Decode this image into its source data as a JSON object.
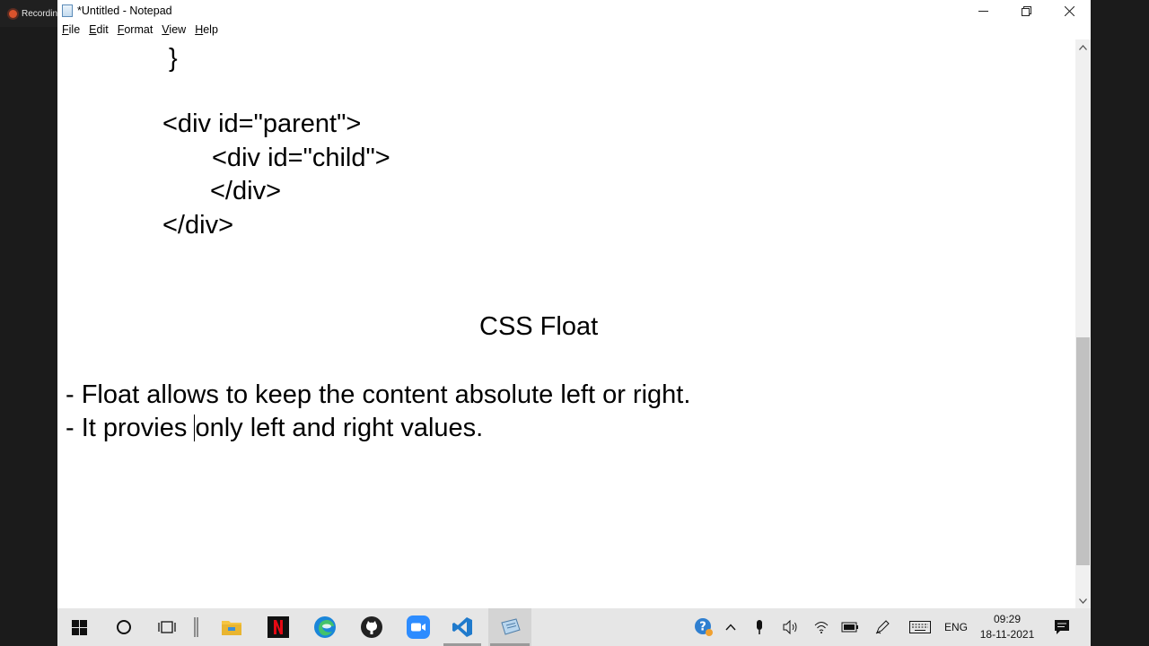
{
  "recording": {
    "label": "Recordin"
  },
  "window": {
    "title": "*Untitled - Notepad",
    "controls": {
      "minimize": "minimize-icon",
      "restore": "restore-icon",
      "close": "close-icon"
    }
  },
  "menu": [
    {
      "first": "F",
      "rest": "ile"
    },
    {
      "first": "E",
      "rest": "dit"
    },
    {
      "first": "F",
      "rest": "ormat"
    },
    {
      "first": "V",
      "rest": "iew"
    },
    {
      "first": "H",
      "rest": "elp"
    }
  ],
  "editor": {
    "lines": [
      "}",
      "<div id=\"parent\">",
      "<div id=\"child\">",
      "</div>",
      "</div>",
      "CSS Float",
      "- Float allows to keep the content absolute left or right."
    ],
    "caret_line": {
      "before": "- It provies ",
      "after": "only left and right values."
    }
  },
  "taskbar": {
    "apps": [
      "windows-start-icon",
      "search-circle-icon",
      "task-view-icon",
      "file-explorer-icon",
      "netflix-icon",
      "edge-icon",
      "github-icon",
      "zoom-icon",
      "vscode-icon",
      "notepad-icon"
    ],
    "tray": {
      "language": "ENG",
      "time": "09:29",
      "date": "18-11-2021"
    }
  },
  "colors": {
    "netflix": "#e50914",
    "edge": "#1a86d9",
    "zoom": "#2d8cff",
    "vscode": "#1f7acc",
    "explorer": "#f5c542",
    "recording_dot": "#d9532c"
  }
}
